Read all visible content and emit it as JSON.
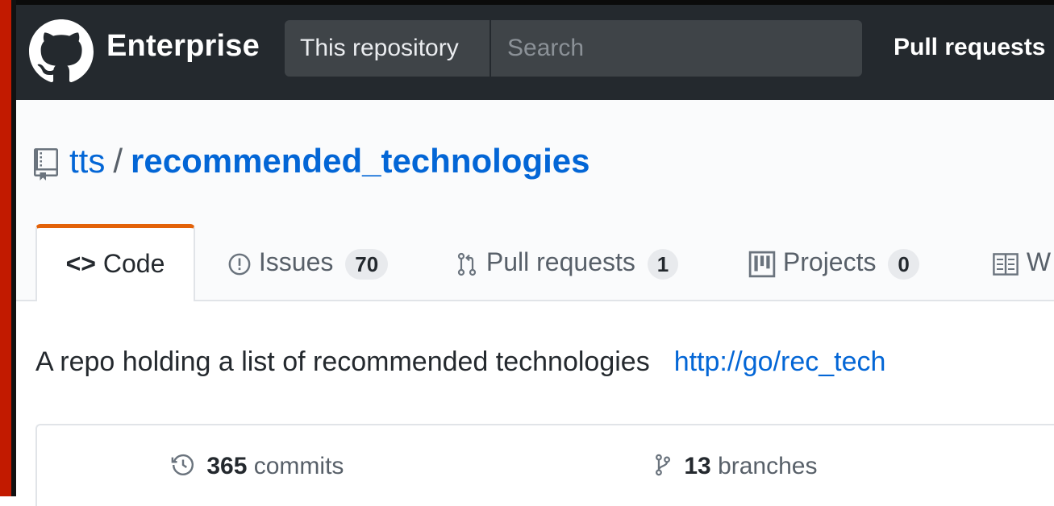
{
  "header": {
    "brand": "Enterprise",
    "scope": "This repository",
    "search_placeholder": "Search",
    "nav_pull_requests": "Pull requests"
  },
  "repo": {
    "owner": "tts",
    "separator": "/",
    "name": "recommended_technologies"
  },
  "tabs": [
    {
      "label": "Code",
      "selected": true
    },
    {
      "label": "Issues",
      "count": "70"
    },
    {
      "label": "Pull requests",
      "count": "1"
    },
    {
      "label": "Projects",
      "count": "0"
    },
    {
      "label": "W"
    }
  ],
  "description": {
    "text": "A repo holding a list of recommended technologies",
    "link": "http://go/rec_tech"
  },
  "summary": {
    "commits_count": "365",
    "commits_label": "commits",
    "branches_count": "13",
    "branches_label": "branches"
  },
  "colors": {
    "header_bg": "#24292e",
    "link": "#0366d6",
    "tab_accent": "#e36209",
    "frame": "#c21a00"
  },
  "icons": [
    "github-logo-icon",
    "repo-icon",
    "code-icon",
    "issue-icon",
    "pull-request-icon",
    "project-icon",
    "wiki-icon",
    "history-icon",
    "branch-icon"
  ]
}
